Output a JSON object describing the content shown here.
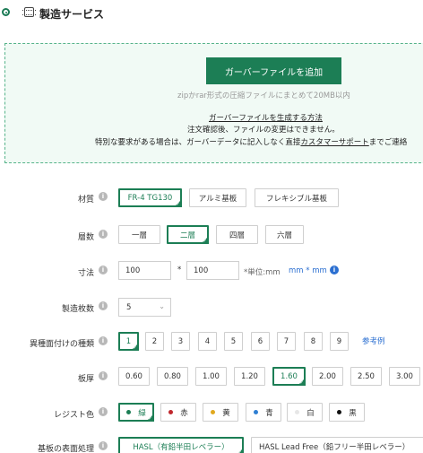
{
  "header": {
    "title": "製造サービス"
  },
  "upload": {
    "button": "ガーバーファイルを追加",
    "note": "zipかrar形式の圧縮ファイルにまとめて20MB以内",
    "how_to_link": "ガーバーファイルを生成する方法",
    "warning": "注文確認後、ファイルの変更はできません。",
    "special_prefix": "特別な要求がある場合は、ガーバーデータに記入しなく直接",
    "support_link": "カスタマーサポート",
    "special_suffix": "までご連絡"
  },
  "material": {
    "label": "材質",
    "options": [
      "FR-4 TG130",
      "アルミ基板",
      "フレキシブル基板"
    ],
    "selected": "FR-4 TG130"
  },
  "layers": {
    "label": "層数",
    "options": [
      "一層",
      "二層",
      "四層",
      "六層"
    ],
    "selected": "二層"
  },
  "size": {
    "label": "寸法",
    "width": "100",
    "times": "*",
    "height": "100",
    "unit_label": "*単位:mm",
    "unit_value": "mm * mm"
  },
  "quantity": {
    "label": "製造枚数",
    "value": "5"
  },
  "variety": {
    "label": "異種面付けの種類",
    "options": [
      "1",
      "2",
      "3",
      "4",
      "5",
      "6",
      "7",
      "8",
      "9"
    ],
    "selected": "1",
    "example_link": "参考例"
  },
  "thickness": {
    "label": "板厚",
    "options": [
      "0.60",
      "0.80",
      "1.00",
      "1.20",
      "1.60",
      "2.00",
      "2.50",
      "3.00"
    ],
    "selected": "1.60"
  },
  "solder_mask": {
    "label": "レジスト色",
    "options": [
      {
        "label": "緑",
        "color": "#1c7e55"
      },
      {
        "label": "赤",
        "color": "#c0282d"
      },
      {
        "label": "黄",
        "color": "#e0a81e"
      },
      {
        "label": "青",
        "color": "#2f7fd3"
      },
      {
        "label": "白",
        "color": "#e6e6e6"
      },
      {
        "label": "黒",
        "color": "#111111"
      }
    ],
    "selected": "緑"
  },
  "finish": {
    "label": "基板の表面処理",
    "options": [
      "HASL（有鉛半田レベラー）",
      "HASL Lead Free（鉛フリー半田レベラー）"
    ],
    "selected": "HASL（有鉛半田レベラー）"
  }
}
